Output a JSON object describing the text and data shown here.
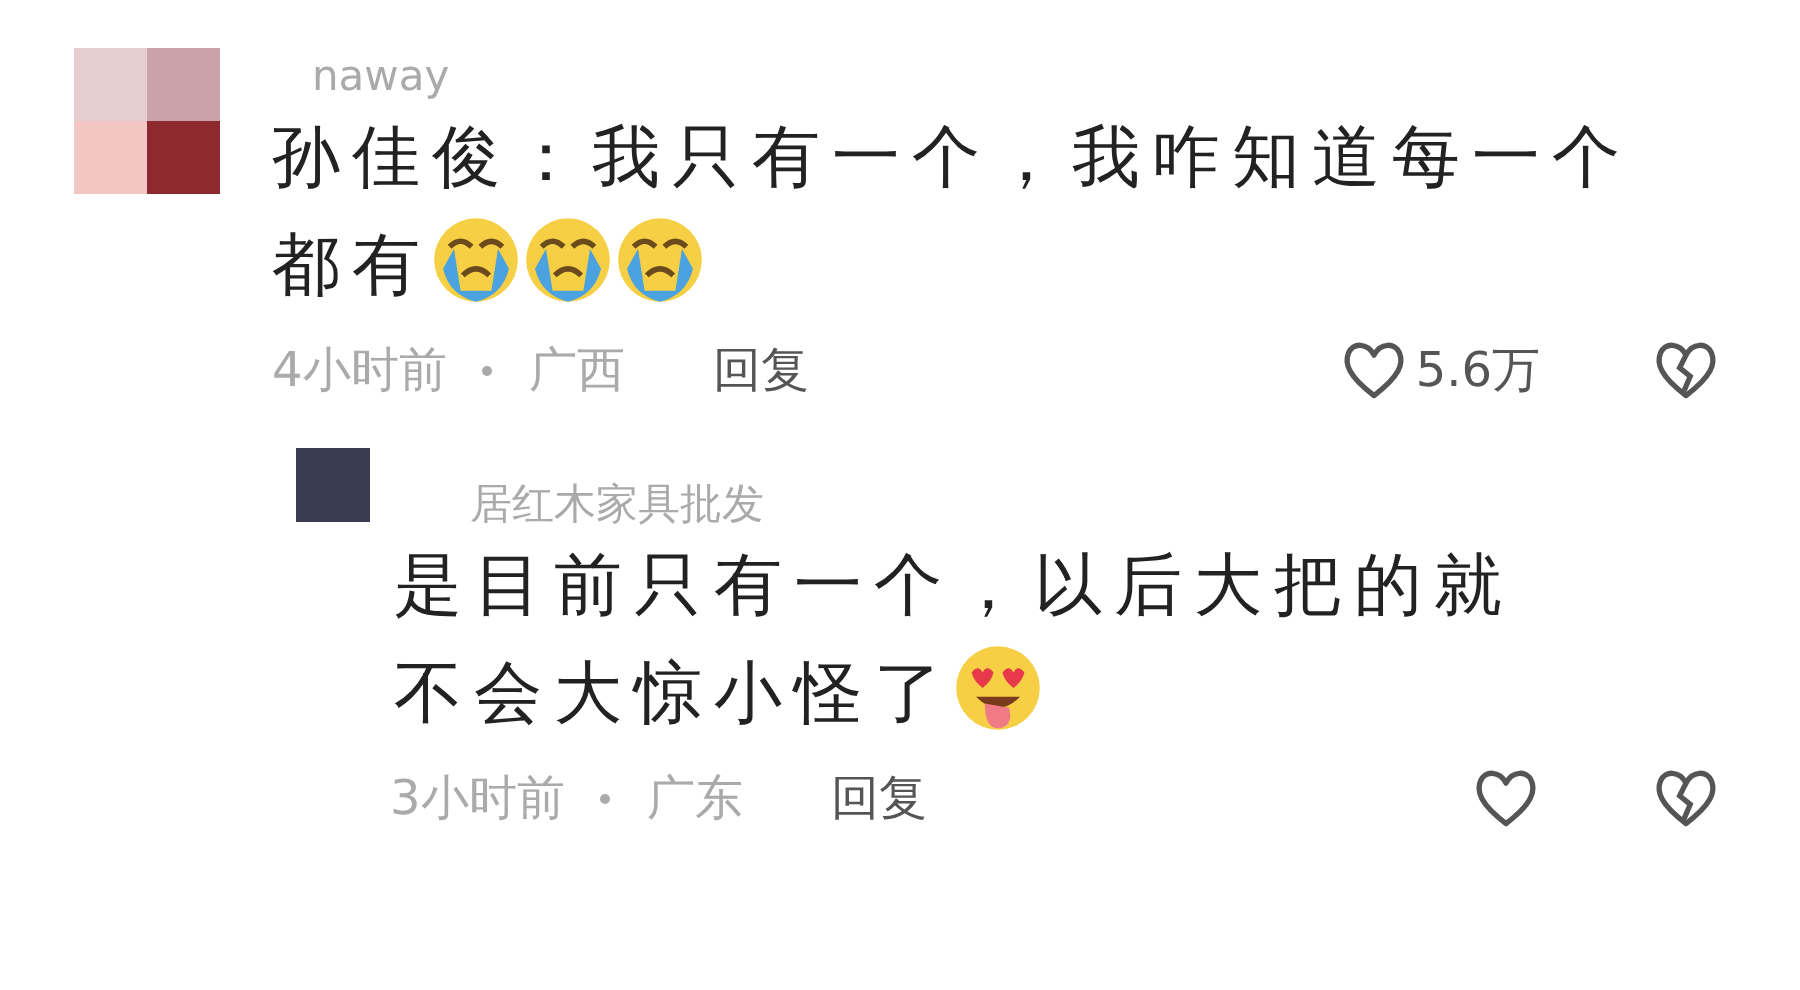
{
  "comments": [
    {
      "username": "naway",
      "text": "孙佳俊：我只有一个，我咋知道每一个都有",
      "emojis": [
        {
          "kind": "crying"
        },
        {
          "kind": "crying"
        },
        {
          "kind": "crying"
        }
      ],
      "time": "4小时前",
      "location": "广西",
      "reply_label": "回复",
      "likes": "5.6万",
      "avatar": {
        "kind": "mosaic"
      },
      "replies": [
        {
          "username": "居红木家具批发",
          "text": "是目前只有一个，以后大把的就不会大惊小怪了",
          "emojis": [
            {
              "kind": "heart-eyes"
            }
          ],
          "time": "3小时前",
          "location": "广东",
          "reply_label": "回复",
          "avatar": {
            "kind": "plain"
          }
        }
      ]
    }
  ]
}
